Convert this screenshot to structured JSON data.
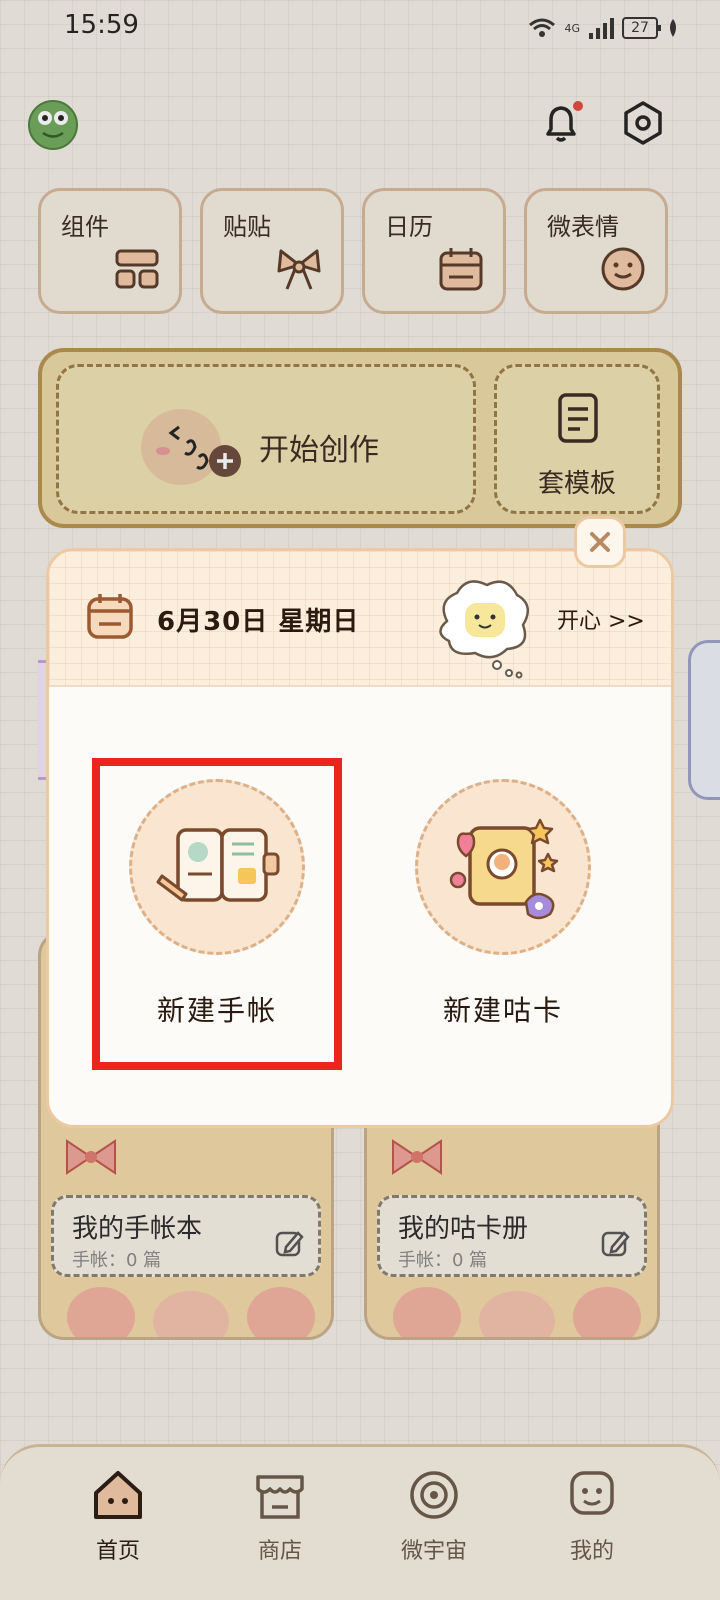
{
  "status": {
    "time": "15:59",
    "network": "4G",
    "battery": "27"
  },
  "header": {
    "notification_dot_color": "#e0493e"
  },
  "tiles": [
    {
      "label": "组件",
      "icon": "widget-grid-icon"
    },
    {
      "label": "贴贴",
      "icon": "sticker-bow-icon"
    },
    {
      "label": "日历",
      "icon": "calendar-icon"
    },
    {
      "label": "微表情",
      "icon": "smiley-face-icon"
    }
  ],
  "create": {
    "start_label": "开始创作",
    "template_label": "套模板"
  },
  "books": [
    {
      "title": "我的手帐本",
      "count": "手帐：0 篇"
    },
    {
      "title": "我的咕卡册",
      "count": "手帐：0 篇"
    }
  ],
  "dialog": {
    "date": "6月30日 星期日",
    "mood_link": "开心 >>",
    "options": [
      {
        "label": "新建手帐",
        "icon": "journal-book-icon"
      },
      {
        "label": "新建咕卡",
        "icon": "goo-card-icon"
      }
    ],
    "highlight_color": "#e8261f"
  },
  "nav": [
    {
      "label": "首页",
      "icon": "home-icon"
    },
    {
      "label": "商店",
      "icon": "shop-icon"
    },
    {
      "label": "微宇宙",
      "icon": "universe-icon"
    },
    {
      "label": "我的",
      "icon": "profile-icon"
    }
  ]
}
